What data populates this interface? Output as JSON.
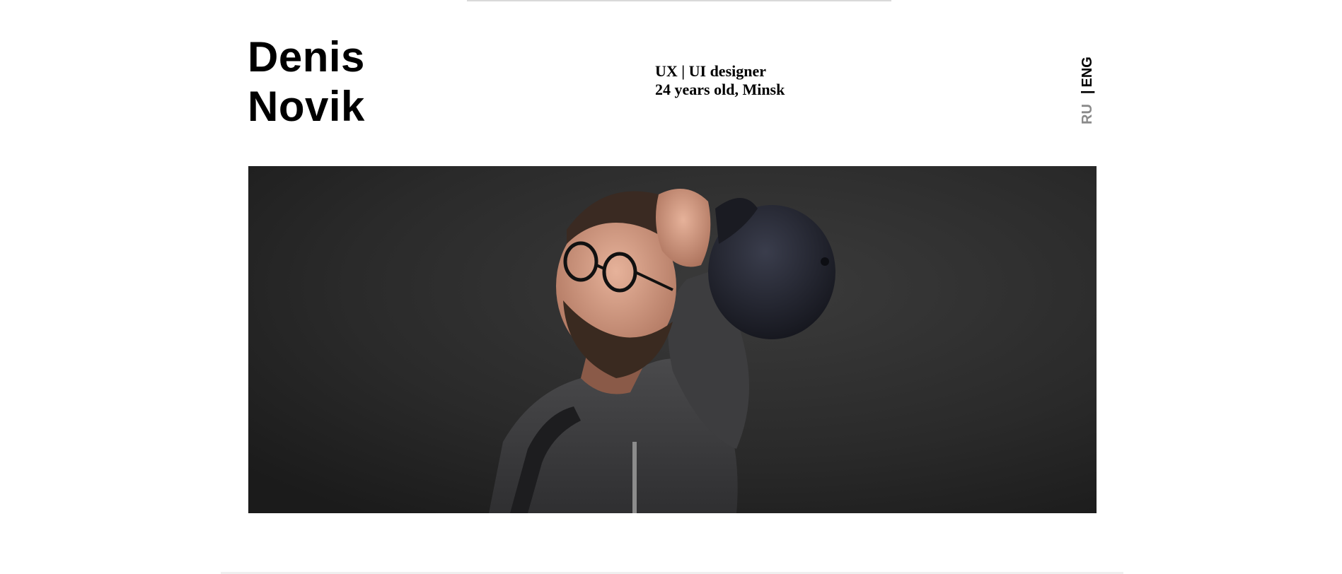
{
  "header": {
    "name_first": "Denis",
    "name_last": "Novik",
    "role": "UX | UI designer",
    "age_location": "24 years old, Minsk"
  },
  "language_switch": {
    "options": [
      "RU",
      "ENG"
    ],
    "separator": "|",
    "active": "ENG",
    "active_color": "#000000",
    "inactive_color": "#8a8a8a"
  },
  "hero_photo": {
    "subject": "portrait of man with glasses and cap on dark wall"
  }
}
